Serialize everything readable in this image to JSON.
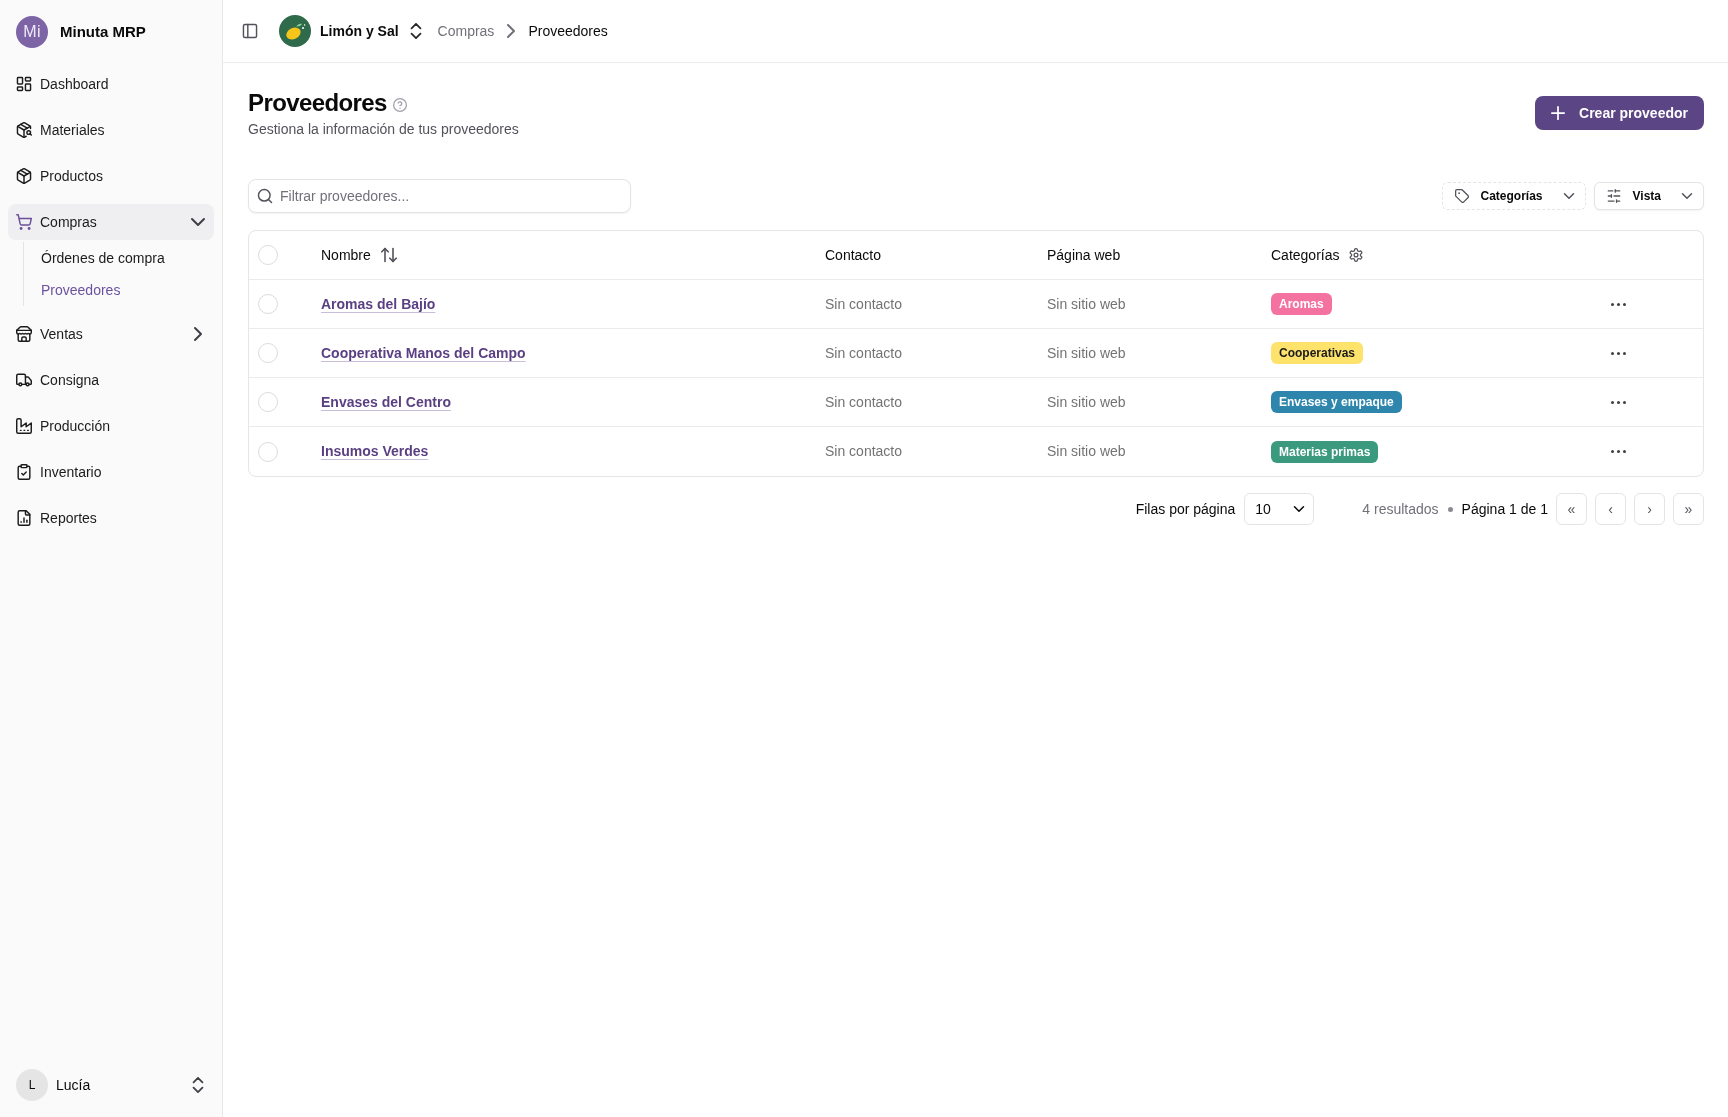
{
  "sidebar": {
    "brand": {
      "logo": "Mi",
      "name": "Minuta MRP"
    },
    "items": [
      {
        "label": "Dashboard",
        "selected": false
      },
      {
        "label": "Materiales",
        "selected": false
      },
      {
        "label": "Productos",
        "selected": false
      },
      {
        "label": "Compras",
        "selected": true,
        "expanded": true,
        "children": [
          {
            "label": "Órdenes de compra",
            "selected": false
          },
          {
            "label": "Proveedores",
            "selected": true
          }
        ]
      },
      {
        "label": "Ventas",
        "selected": false,
        "expanded": false
      },
      {
        "label": "Consigna",
        "selected": false
      },
      {
        "label": "Producción",
        "selected": false
      },
      {
        "label": "Inventario",
        "selected": false
      },
      {
        "label": "Reportes",
        "selected": false
      }
    ],
    "user": {
      "initial": "L",
      "name": "Lucía"
    }
  },
  "topbar": {
    "organization": "Limón y Sal",
    "breadcrumbs": [
      {
        "label": "Compras",
        "current": false
      },
      {
        "label": "Proveedores",
        "current": true
      }
    ]
  },
  "page": {
    "title": "Proveedores",
    "subtitle": "Gestiona la información de tus proveedores",
    "create_button": "Crear proveedor"
  },
  "toolbar": {
    "search": {
      "placeholder": "Filtrar proveedores..."
    },
    "buttons": [
      {
        "kind": "facet",
        "label": "Categorías"
      },
      {
        "kind": "view",
        "label": "Vista"
      }
    ]
  },
  "table": {
    "all_selected": false,
    "columns": [
      {
        "kind": "sort",
        "label": "Nombre"
      },
      {
        "kind": "plain",
        "label": "Contacto"
      },
      {
        "kind": "plain",
        "label": "Página web"
      },
      {
        "kind": "settings",
        "label": "Categorías"
      }
    ],
    "rows": [
      {
        "selected": false,
        "name": "Aromas del Bajío",
        "contact": "Sin contacto",
        "website": "Sin sitio web",
        "categories": [
          {
            "label": "Aromas",
            "color": "#f472a0"
          }
        ]
      },
      {
        "selected": false,
        "name": "Cooperativa Manos del Campo",
        "contact": "Sin contacto",
        "website": "Sin sitio web",
        "categories": [
          {
            "label": "Cooperativas",
            "color": "#fde26c"
          }
        ]
      },
      {
        "selected": false,
        "name": "Envases del Centro",
        "contact": "Sin contacto",
        "website": "Sin sitio web",
        "categories": [
          {
            "label": "Envases y empaque",
            "color": "#2f86ad"
          }
        ]
      },
      {
        "selected": false,
        "name": "Insumos Verdes",
        "contact": "Sin contacto",
        "website": "Sin sitio web",
        "categories": [
          {
            "label": "Materias primas",
            "color": "#3b9a7e"
          }
        ]
      }
    ]
  },
  "pagination": {
    "rows_per_page_label": "Filas por página",
    "rows_per_page": "10",
    "results": "4 resultados",
    "page": "Página 1 de 1",
    "buttons": [
      "«",
      "‹",
      "›",
      "»"
    ]
  }
}
